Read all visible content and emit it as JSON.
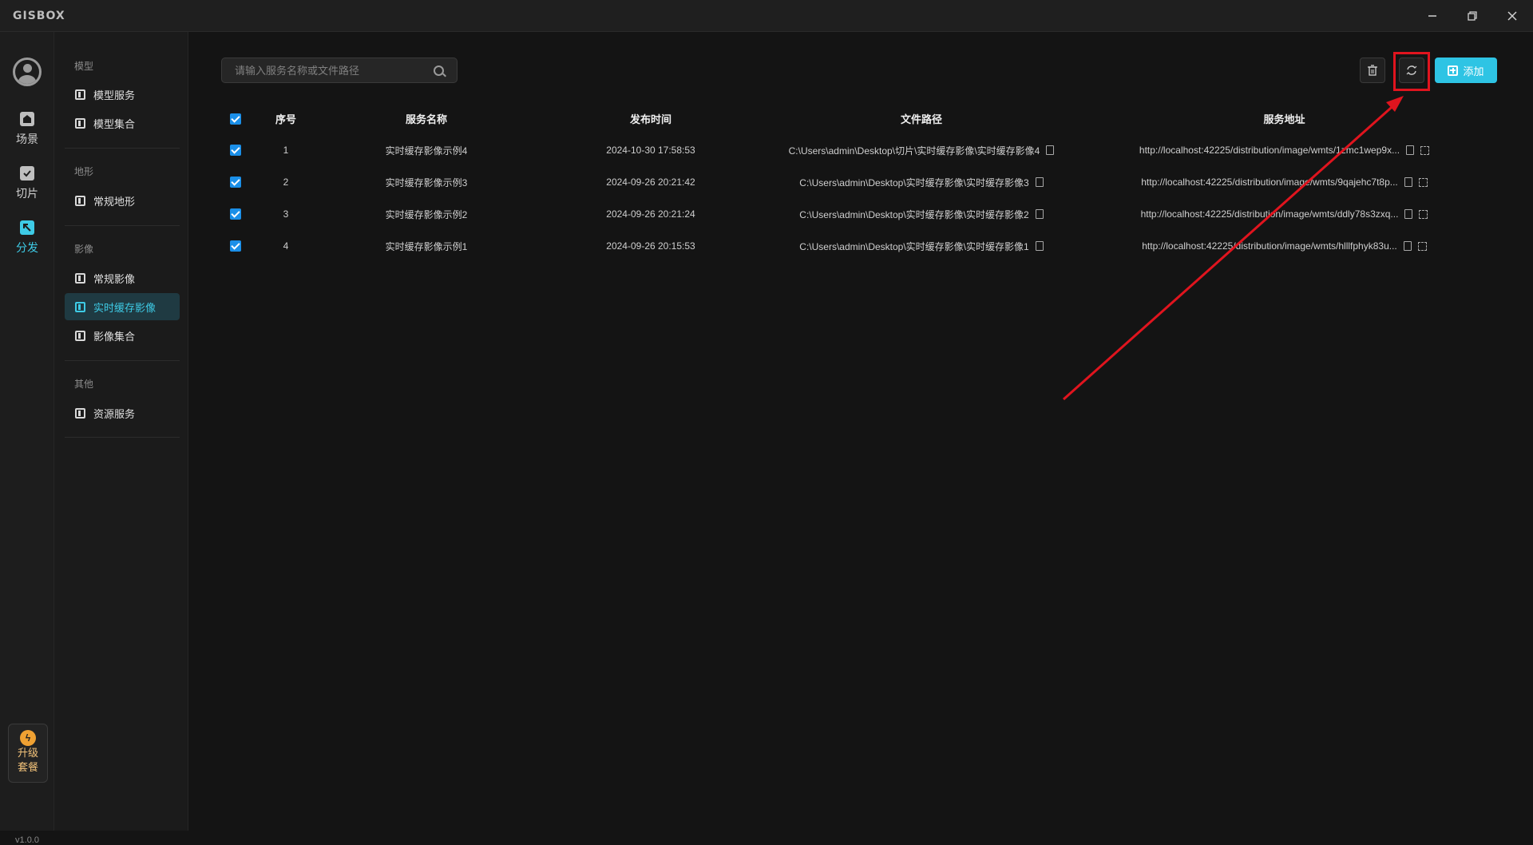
{
  "app": {
    "logo": "GISBOX",
    "version": "v1.0.0"
  },
  "rail": {
    "items": [
      {
        "label": "场景",
        "icon": "home-icon"
      },
      {
        "label": "切片",
        "icon": "slice-icon"
      },
      {
        "label": "分发",
        "icon": "distribute-icon"
      }
    ],
    "upgrade_line1": "升级",
    "upgrade_line2": "套餐"
  },
  "sidebar": {
    "groups": [
      {
        "title": "模型",
        "items": [
          "模型服务",
          "模型集合"
        ]
      },
      {
        "title": "地形",
        "items": [
          "常规地形"
        ]
      },
      {
        "title": "影像",
        "items": [
          "常规影像",
          "实时缓存影像",
          "影像集合"
        ]
      },
      {
        "title": "其他",
        "items": [
          "资源服务"
        ]
      }
    ]
  },
  "toolbar": {
    "search_placeholder": "请输入服务名称或文件路径",
    "add_label": "添加"
  },
  "table": {
    "headers": [
      "序号",
      "服务名称",
      "发布时间",
      "文件路径",
      "服务地址"
    ],
    "rows": [
      {
        "index": "1",
        "name": "实时缓存影像示例4",
        "time": "2024-10-30 17:58:53",
        "path": "C:\\Users\\admin\\Desktop\\切片\\实时缓存影像\\实时缓存影像4",
        "url": "http://localhost:42225/distribution/image/wmts/1zmc1wep9x..."
      },
      {
        "index": "2",
        "name": "实时缓存影像示例3",
        "time": "2024-09-26 20:21:42",
        "path": "C:\\Users\\admin\\Desktop\\实时缓存影像\\实时缓存影像3",
        "url": "http://localhost:42225/distribution/image/wmts/9qajehc7t8p..."
      },
      {
        "index": "3",
        "name": "实时缓存影像示例2",
        "time": "2024-09-26 20:21:24",
        "path": "C:\\Users\\admin\\Desktop\\实时缓存影像\\实时缓存影像2",
        "url": "http://localhost:42225/distribution/image/wmts/ddly78s3zxq..."
      },
      {
        "index": "4",
        "name": "实时缓存影像示例1",
        "time": "2024-09-26 20:15:53",
        "path": "C:\\Users\\admin\\Desktop\\实时缓存影像\\实时缓存影像1",
        "url": "http://localhost:42225/distribution/image/wmts/hlllfphyk83u..."
      }
    ]
  },
  "colors": {
    "accent": "#3ecbe6",
    "annotation": "#e0141e",
    "checkbox": "#1b8fe8"
  }
}
